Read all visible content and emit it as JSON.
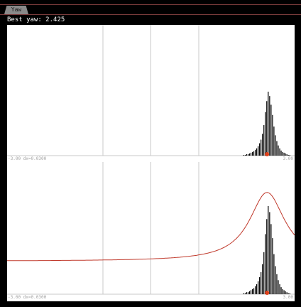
{
  "tab": {
    "label": "Yaw"
  },
  "status": {
    "text": "Best yaw: 2.425"
  },
  "axis": {
    "min_label": "-3.00 dx=0.0300",
    "max_label": "3.00"
  },
  "chart_data": [
    {
      "type": "bar",
      "x_range": [
        -3.0,
        3.0
      ],
      "bin_width": 0.03,
      "gridlines_x": [
        -1.0,
        0.0,
        1.0
      ],
      "best_x": 2.425,
      "histogram": {
        "center": 2.425,
        "counts": [
          1,
          1,
          2,
          2,
          3,
          4,
          5,
          6,
          8,
          10,
          13,
          17,
          22,
          30,
          42,
          60,
          75,
          88,
          82,
          70,
          56,
          40,
          28,
          20,
          14,
          10,
          7,
          5,
          4,
          3,
          2,
          1,
          1
        ]
      },
      "colors": {
        "bars": "#000000",
        "marker": "#e0401a",
        "grid": "#c8c8c8"
      }
    },
    {
      "type": "bar",
      "x_range": [
        -3.0,
        3.0
      ],
      "bin_width": 0.03,
      "gridlines_x": [
        -1.0,
        0.0,
        1.0
      ],
      "best_x": 2.425,
      "histogram": {
        "center": 2.425,
        "counts": [
          1,
          1,
          2,
          2,
          3,
          4,
          5,
          6,
          8,
          10,
          13,
          17,
          22,
          30,
          42,
          60,
          75,
          88,
          82,
          70,
          56,
          40,
          28,
          20,
          14,
          10,
          7,
          5,
          4,
          3,
          2,
          1,
          1
        ]
      },
      "curve": {
        "type": "line",
        "peak_x": 2.425,
        "baseline": 0.25,
        "peak": 0.77,
        "width": 0.45
      },
      "colors": {
        "bars": "#000000",
        "marker": "#e0401a",
        "grid": "#c8c8c8",
        "curve": "#c0392b"
      }
    }
  ]
}
